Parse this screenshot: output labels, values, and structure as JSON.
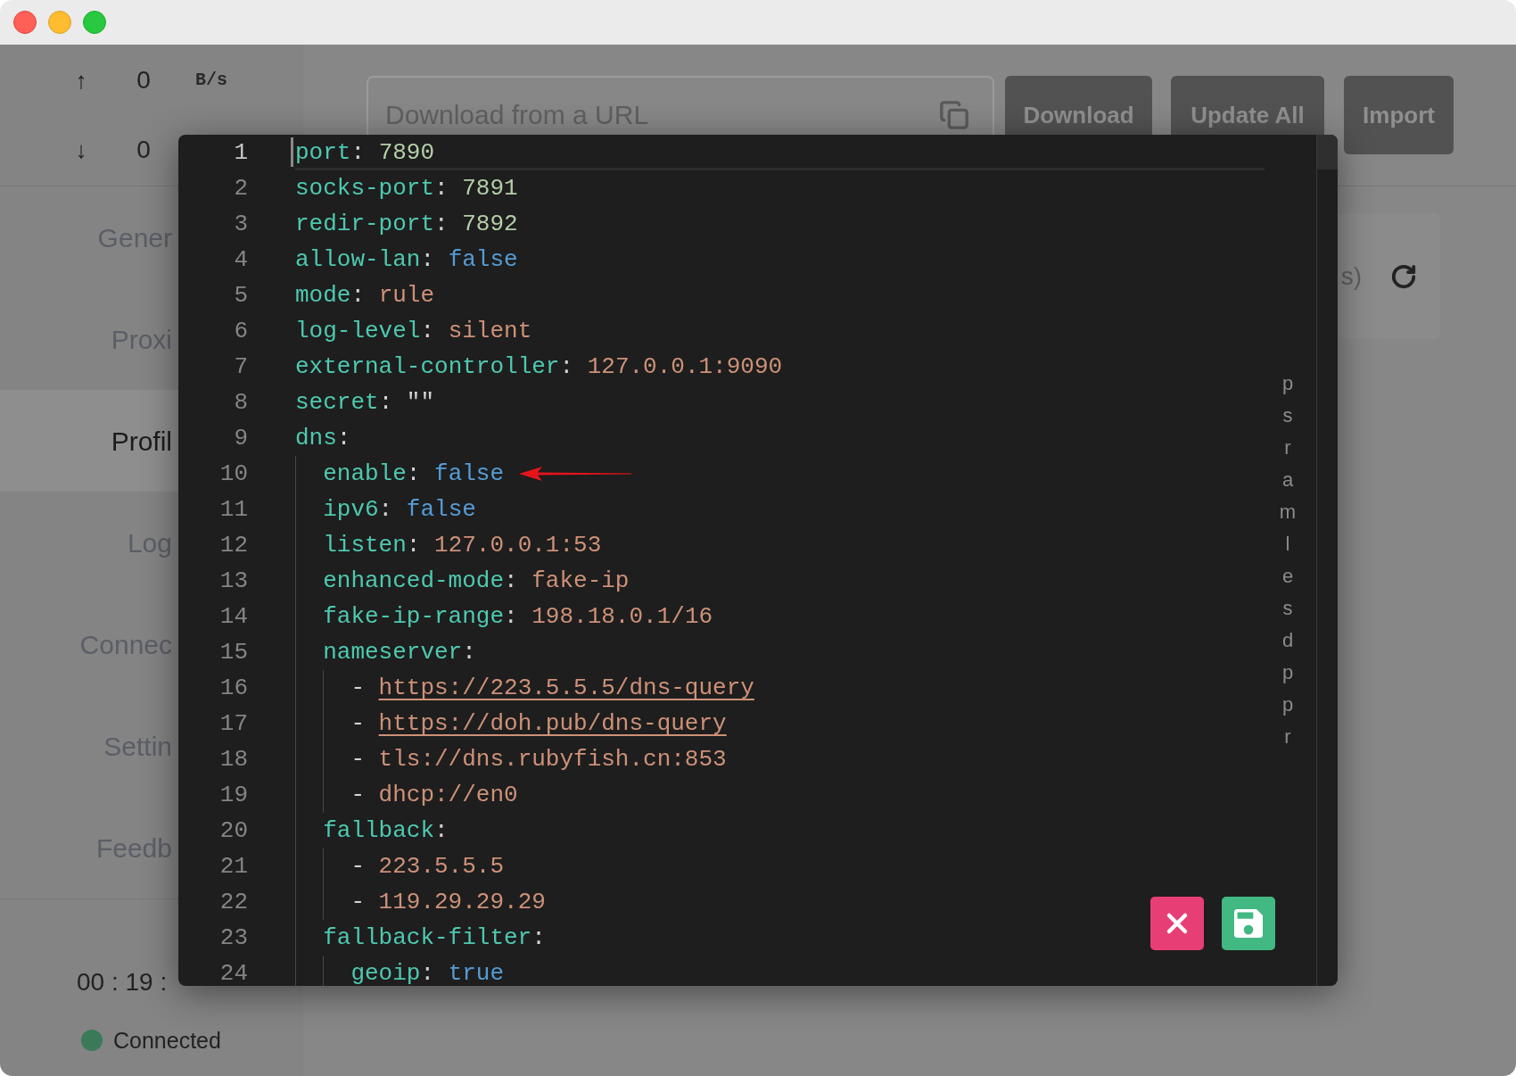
{
  "sidebar": {
    "traffic": [
      {
        "arrow": "↑",
        "value": "0",
        "unit": "B/s"
      },
      {
        "arrow": "↓",
        "value": "0"
      }
    ],
    "nav": [
      {
        "label": "Gener",
        "selected": false
      },
      {
        "label": "Proxi",
        "selected": false
      },
      {
        "label": "Profil",
        "selected": true
      },
      {
        "label": "Log",
        "selected": false
      },
      {
        "label": "Connec",
        "selected": false
      },
      {
        "label": "Settin",
        "selected": false
      },
      {
        "label": "Feedb",
        "selected": false
      }
    ],
    "timer": "00 : 19 :",
    "status": {
      "label": "Connected",
      "connected": true
    }
  },
  "toolbar": {
    "url_field": {
      "placeholder": "Download from a URL"
    },
    "buttons": [
      "Download",
      "Update All",
      "Import"
    ]
  },
  "card": {
    "text": "s)"
  },
  "editor": {
    "lines": [
      {
        "number": "1",
        "active": true,
        "annotated": false,
        "tokens": [
          {
            "kind": "key",
            "text": "port"
          },
          {
            "kind": "punct",
            "text": ": "
          },
          {
            "kind": "number",
            "text": "7890"
          }
        ]
      },
      {
        "number": "2",
        "active": false,
        "annotated": false,
        "tokens": [
          {
            "kind": "key",
            "text": "socks-port"
          },
          {
            "kind": "punct",
            "text": ": "
          },
          {
            "kind": "number",
            "text": "7891"
          }
        ]
      },
      {
        "number": "3",
        "active": false,
        "annotated": false,
        "tokens": [
          {
            "kind": "key",
            "text": "redir-port"
          },
          {
            "kind": "punct",
            "text": ": "
          },
          {
            "kind": "number",
            "text": "7892"
          }
        ]
      },
      {
        "number": "4",
        "active": false,
        "annotated": false,
        "tokens": [
          {
            "kind": "key",
            "text": "allow-lan"
          },
          {
            "kind": "punct",
            "text": ": "
          },
          {
            "kind": "bool",
            "text": "false"
          }
        ]
      },
      {
        "number": "5",
        "active": false,
        "annotated": false,
        "tokens": [
          {
            "kind": "key",
            "text": "mode"
          },
          {
            "kind": "punct",
            "text": ": "
          },
          {
            "kind": "string",
            "text": "rule"
          }
        ]
      },
      {
        "number": "6",
        "active": false,
        "annotated": false,
        "tokens": [
          {
            "kind": "key",
            "text": "log-level"
          },
          {
            "kind": "punct",
            "text": ": "
          },
          {
            "kind": "string",
            "text": "silent"
          }
        ]
      },
      {
        "number": "7",
        "active": false,
        "annotated": false,
        "tokens": [
          {
            "kind": "key",
            "text": "external-controller"
          },
          {
            "kind": "punct",
            "text": ": "
          },
          {
            "kind": "string",
            "text": "127.0.0.1:9090"
          }
        ]
      },
      {
        "number": "8",
        "active": false,
        "annotated": false,
        "tokens": [
          {
            "kind": "key",
            "text": "secret"
          },
          {
            "kind": "punct",
            "text": ": "
          },
          {
            "kind": "plain",
            "text": "\"\""
          }
        ]
      },
      {
        "number": "9",
        "active": false,
        "annotated": false,
        "tokens": [
          {
            "kind": "key",
            "text": "dns"
          },
          {
            "kind": "punct",
            "text": ":"
          }
        ],
        "children": [
          {
            "number": "10",
            "active": false,
            "annotated": true,
            "tokens": [
              {
                "kind": "key",
                "text": "enable"
              },
              {
                "kind": "punct",
                "text": ": "
              },
              {
                "kind": "bool",
                "text": "false"
              }
            ]
          },
          {
            "number": "11",
            "active": false,
            "annotated": false,
            "tokens": [
              {
                "kind": "key",
                "text": "ipv6"
              },
              {
                "kind": "punct",
                "text": ": "
              },
              {
                "kind": "bool",
                "text": "false"
              }
            ]
          },
          {
            "number": "12",
            "active": false,
            "annotated": false,
            "tokens": [
              {
                "kind": "key",
                "text": "listen"
              },
              {
                "kind": "punct",
                "text": ": "
              },
              {
                "kind": "string",
                "text": "127.0.0.1:53"
              }
            ]
          },
          {
            "number": "13",
            "active": false,
            "annotated": false,
            "tokens": [
              {
                "kind": "key",
                "text": "enhanced-mode"
              },
              {
                "kind": "punct",
                "text": ": "
              },
              {
                "kind": "string",
                "text": "fake-ip"
              }
            ]
          },
          {
            "number": "14",
            "active": false,
            "annotated": false,
            "tokens": [
              {
                "kind": "key",
                "text": "fake-ip-range"
              },
              {
                "kind": "punct",
                "text": ": "
              },
              {
                "kind": "string",
                "text": "198.18.0.1/16"
              }
            ]
          },
          {
            "number": "15",
            "active": false,
            "annotated": false,
            "tokens": [
              {
                "kind": "key",
                "text": "nameserver"
              },
              {
                "kind": "punct",
                "text": ":"
              }
            ],
            "children": [
              {
                "number": "16",
                "active": false,
                "annotated": false,
                "tokens": [
                  {
                    "kind": "punct",
                    "text": "- "
                  },
                  {
                    "kind": "link",
                    "text": "https://223.5.5.5/dns-query"
                  }
                ]
              },
              {
                "number": "17",
                "active": false,
                "annotated": false,
                "tokens": [
                  {
                    "kind": "punct",
                    "text": "- "
                  },
                  {
                    "kind": "link",
                    "text": "https://doh.pub/dns-query"
                  }
                ]
              },
              {
                "number": "18",
                "active": false,
                "annotated": false,
                "tokens": [
                  {
                    "kind": "punct",
                    "text": "- "
                  },
                  {
                    "kind": "string",
                    "text": "tls://dns.rubyfish.cn:853"
                  }
                ]
              },
              {
                "number": "19",
                "active": false,
                "annotated": false,
                "tokens": [
                  {
                    "kind": "punct",
                    "text": "- "
                  },
                  {
                    "kind": "string",
                    "text": "dhcp://en0"
                  }
                ]
              }
            ]
          },
          {
            "number": "20",
            "active": false,
            "annotated": false,
            "tokens": [
              {
                "kind": "key",
                "text": "fallback"
              },
              {
                "kind": "punct",
                "text": ":"
              }
            ],
            "children": [
              {
                "number": "21",
                "active": false,
                "annotated": false,
                "tokens": [
                  {
                    "kind": "punct",
                    "text": "- "
                  },
                  {
                    "kind": "string",
                    "text": "223.5.5.5"
                  }
                ]
              },
              {
                "number": "22",
                "active": false,
                "annotated": false,
                "tokens": [
                  {
                    "kind": "punct",
                    "text": "- "
                  },
                  {
                    "kind": "string",
                    "text": "119.29.29.29"
                  }
                ]
              }
            ]
          },
          {
            "number": "23",
            "active": false,
            "annotated": false,
            "tokens": [
              {
                "kind": "key",
                "text": "fallback-filter"
              },
              {
                "kind": "punct",
                "text": ":"
              }
            ],
            "children": [
              {
                "number": "24",
                "active": false,
                "annotated": false,
                "tokens": [
                  {
                    "kind": "key",
                    "text": "geoip"
                  },
                  {
                    "kind": "punct",
                    "text": ": "
                  },
                  {
                    "kind": "bool",
                    "text": "true"
                  }
                ]
              }
            ]
          }
        ]
      }
    ],
    "outline": [
      "p",
      "s",
      "r",
      "a",
      "m",
      "l",
      "e",
      "s",
      "d",
      "p",
      "p",
      "r"
    ],
    "actions": [
      {
        "kind": "close"
      },
      {
        "kind": "save"
      }
    ]
  }
}
